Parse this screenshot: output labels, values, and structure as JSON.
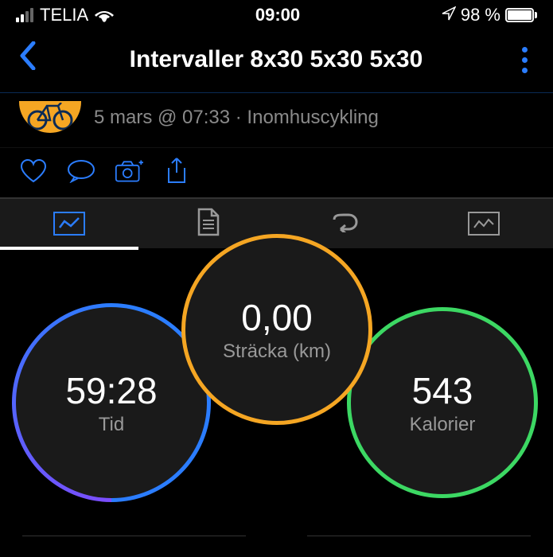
{
  "statusbar": {
    "carrier": "TELIA",
    "time": "09:00",
    "battery_pct": "98 %"
  },
  "nav": {
    "title": "Intervaller 8x30 5x30 5x30"
  },
  "activity": {
    "meta": "5 mars @ 07:33 · Inomhuscykling"
  },
  "gauges": {
    "time": {
      "value": "59:28",
      "label": "Tid"
    },
    "distance": {
      "value": "0,00",
      "label": "Sträcka (km)"
    },
    "calories": {
      "value": "543",
      "label": "Kalorier"
    }
  }
}
